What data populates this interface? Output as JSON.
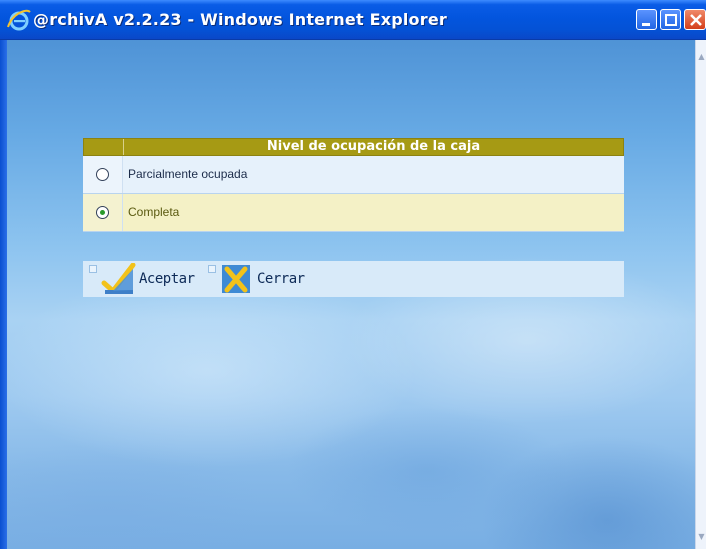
{
  "window": {
    "title": "@rchivA v2.2.23 - Windows Internet Explorer",
    "controls": [
      "minimize",
      "maximize",
      "close"
    ]
  },
  "panel": {
    "title": "Nivel de ocupación de la caja",
    "options": [
      {
        "label": "Parcialmente ocupada",
        "selected": false
      },
      {
        "label": "Completa",
        "selected": true
      }
    ]
  },
  "actions": {
    "accept_label": "Aceptar",
    "close_label": "Cerrar"
  },
  "colors": {
    "header": "#a69a14",
    "accent": "#f2c21a",
    "titlebar": "#0355de"
  }
}
